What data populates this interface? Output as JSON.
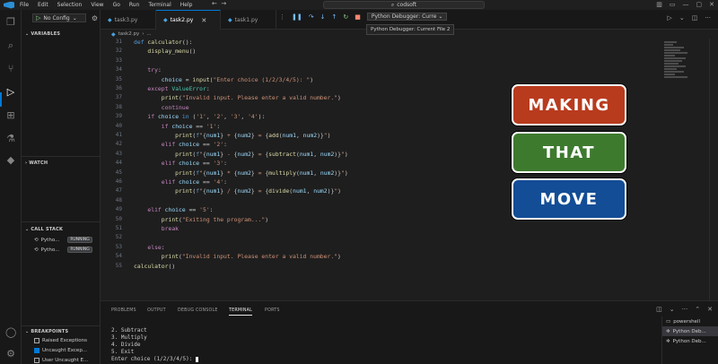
{
  "titlebar": {
    "menu": [
      "File",
      "Edit",
      "Selection",
      "View",
      "Go",
      "Run",
      "Terminal",
      "Help"
    ],
    "search": "codsoft"
  },
  "run": {
    "config": "No Config",
    "sections": {
      "variables": "VARIABLES",
      "watch": "WATCH",
      "callstack": "CALL STACK",
      "breakpoints": "BREAKPOINTS"
    },
    "threads": [
      {
        "name": "Pytho...",
        "state": "RUNNING"
      },
      {
        "name": "Pytho...",
        "state": "RUNNING"
      }
    ],
    "breakpoints": [
      {
        "label": "Raised Exceptions",
        "checked": false
      },
      {
        "label": "Uncaught Excep...",
        "checked": true
      },
      {
        "label": "User Uncaught E...",
        "checked": false
      }
    ]
  },
  "tabs": [
    {
      "label": "task3.py",
      "active": false
    },
    {
      "label": "task2.py",
      "active": true
    },
    {
      "label": "task1.py",
      "active": false
    }
  ],
  "debug": {
    "config": "Python Debugger: Curre",
    "tooltip": "Python Debugger: Current File 2"
  },
  "breadcrumb": {
    "file": "task2.py",
    "rest": "..."
  },
  "code": {
    "lines": [
      {
        "n": "31",
        "text": "def calculator():"
      },
      {
        "n": "32",
        "text": "    display_menu()"
      },
      {
        "n": "33",
        "text": ""
      },
      {
        "n": "34",
        "text": "    try:"
      },
      {
        "n": "35",
        "text": "        choice = input(\"Enter choice (1/2/3/4/5): \")"
      },
      {
        "n": "36",
        "text": "    except ValueError:"
      },
      {
        "n": "37",
        "text": "        print(\"Invalid input. Please enter a valid number.\")"
      },
      {
        "n": "38",
        "text": "        continue"
      },
      {
        "n": "39",
        "text": "    if choice in ('1', '2', '3', '4'):"
      },
      {
        "n": "40",
        "text": "        if choice == '1':"
      },
      {
        "n": "41",
        "text": "            print(f\"{num1} + {num2} = {add(num1, num2)}\")"
      },
      {
        "n": "42",
        "text": "        elif choice == '2':"
      },
      {
        "n": "43",
        "text": "            print(f\"{num1} - {num2} = {subtract(num1, num2)}\")"
      },
      {
        "n": "44",
        "text": "        elif choice == '3':"
      },
      {
        "n": "45",
        "text": "            print(f\"{num1} * {num2} = {multiply(num1, num2)}\")"
      },
      {
        "n": "46",
        "text": "        elif choice == '4':"
      },
      {
        "n": "47",
        "text": "            print(f\"{num1} / {num2} = {divide(num1, num2)}\")"
      },
      {
        "n": "48",
        "text": ""
      },
      {
        "n": "49",
        "text": "    elif choice == '5':"
      },
      {
        "n": "50",
        "text": "        print(\"Exiting the program...\")"
      },
      {
        "n": "51",
        "text": "        break"
      },
      {
        "n": "52",
        "text": ""
      },
      {
        "n": "53",
        "text": "    else:"
      },
      {
        "n": "54",
        "text": "        print(\"Invalid input. Please enter a valid number.\")"
      },
      {
        "n": "55",
        "text": "calculator()"
      }
    ]
  },
  "overlay": {
    "making": {
      "label": "MAKING",
      "color": "#b83b1e"
    },
    "that": {
      "label": "THAT",
      "color": "#3d7a2e"
    },
    "move": {
      "label": "MOVE",
      "color": "#134d96"
    }
  },
  "panel": {
    "tabs": [
      "PROBLEMS",
      "OUTPUT",
      "DEBUG CONSOLE",
      "TERMINAL",
      "PORTS"
    ],
    "terminal_lines": [
      "2. Subtract",
      "3. Multiply",
      "4. Divide",
      "5. Exit",
      "Enter choice (1/2/3/4/5): "
    ],
    "terminals": [
      "powershell",
      "Python Deb...",
      "Python Deb..."
    ]
  }
}
